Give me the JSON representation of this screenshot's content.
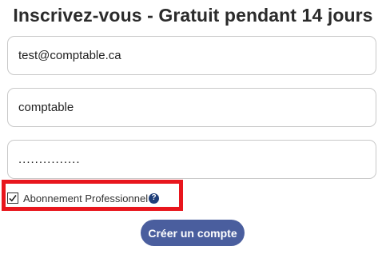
{
  "header": {
    "title": "Inscrivez-vous - Gratuit pendant 14 jours"
  },
  "form": {
    "email_value": "test@comptable.ca",
    "company_value": "comptable",
    "password_value": "..............."
  },
  "subscription": {
    "checked": true,
    "label": "Abonnement Professionnel",
    "help_icon": "question-circle-icon",
    "help_glyph": "?"
  },
  "submit": {
    "label": "Créer un compte"
  },
  "colors": {
    "highlight": "#e8161d",
    "button": "#4a5e9e",
    "help_icon": "#1f3f7a"
  }
}
